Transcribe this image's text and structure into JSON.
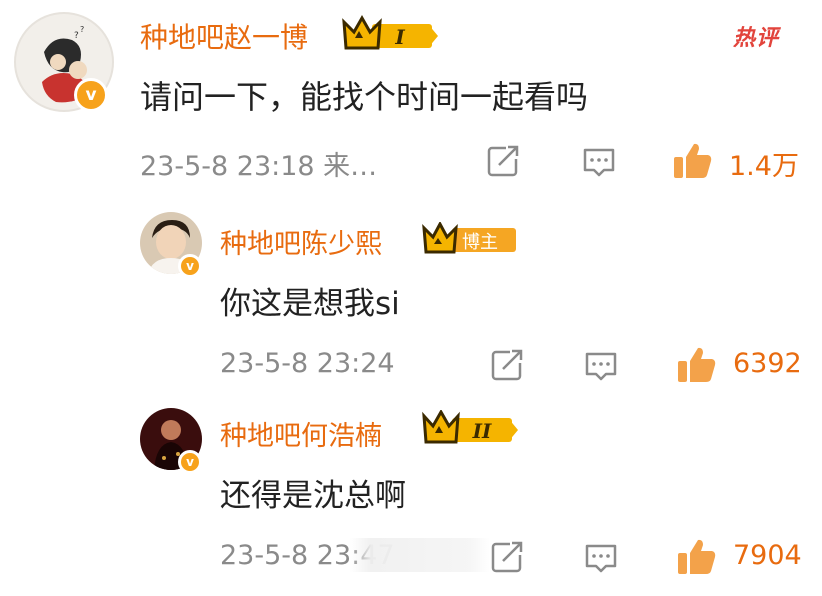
{
  "hot_label": "热评",
  "comments": [
    {
      "username": "种地吧赵一博",
      "badge_level": "I",
      "badge_type": "rank",
      "text": "请问一下，能找个时间一起看吗",
      "time": "23-5-8 23:18 来…",
      "likes": "1.4万"
    },
    {
      "username": "种地吧陈少熙",
      "badge_level": "",
      "badge_type": "blogger",
      "badge_label": "博主",
      "text": "你这是想我si",
      "time": "23-5-8 23:24",
      "likes": "6392"
    },
    {
      "username": "种地吧何浩楠",
      "badge_level": "II",
      "badge_type": "rank",
      "text": "还得是沈总啊",
      "time": "23-5-8 23:47",
      "likes": "7904"
    }
  ],
  "icons": {
    "share": "share-icon",
    "reply": "comment-icon",
    "like": "thumbs-up-icon",
    "verified": "verified-v-icon",
    "crown": "crown-icon"
  },
  "colors": {
    "username": "#e86b0f",
    "hot": "#e2443c",
    "meta": "#8a8a8a",
    "verified": "#f7a21b"
  }
}
